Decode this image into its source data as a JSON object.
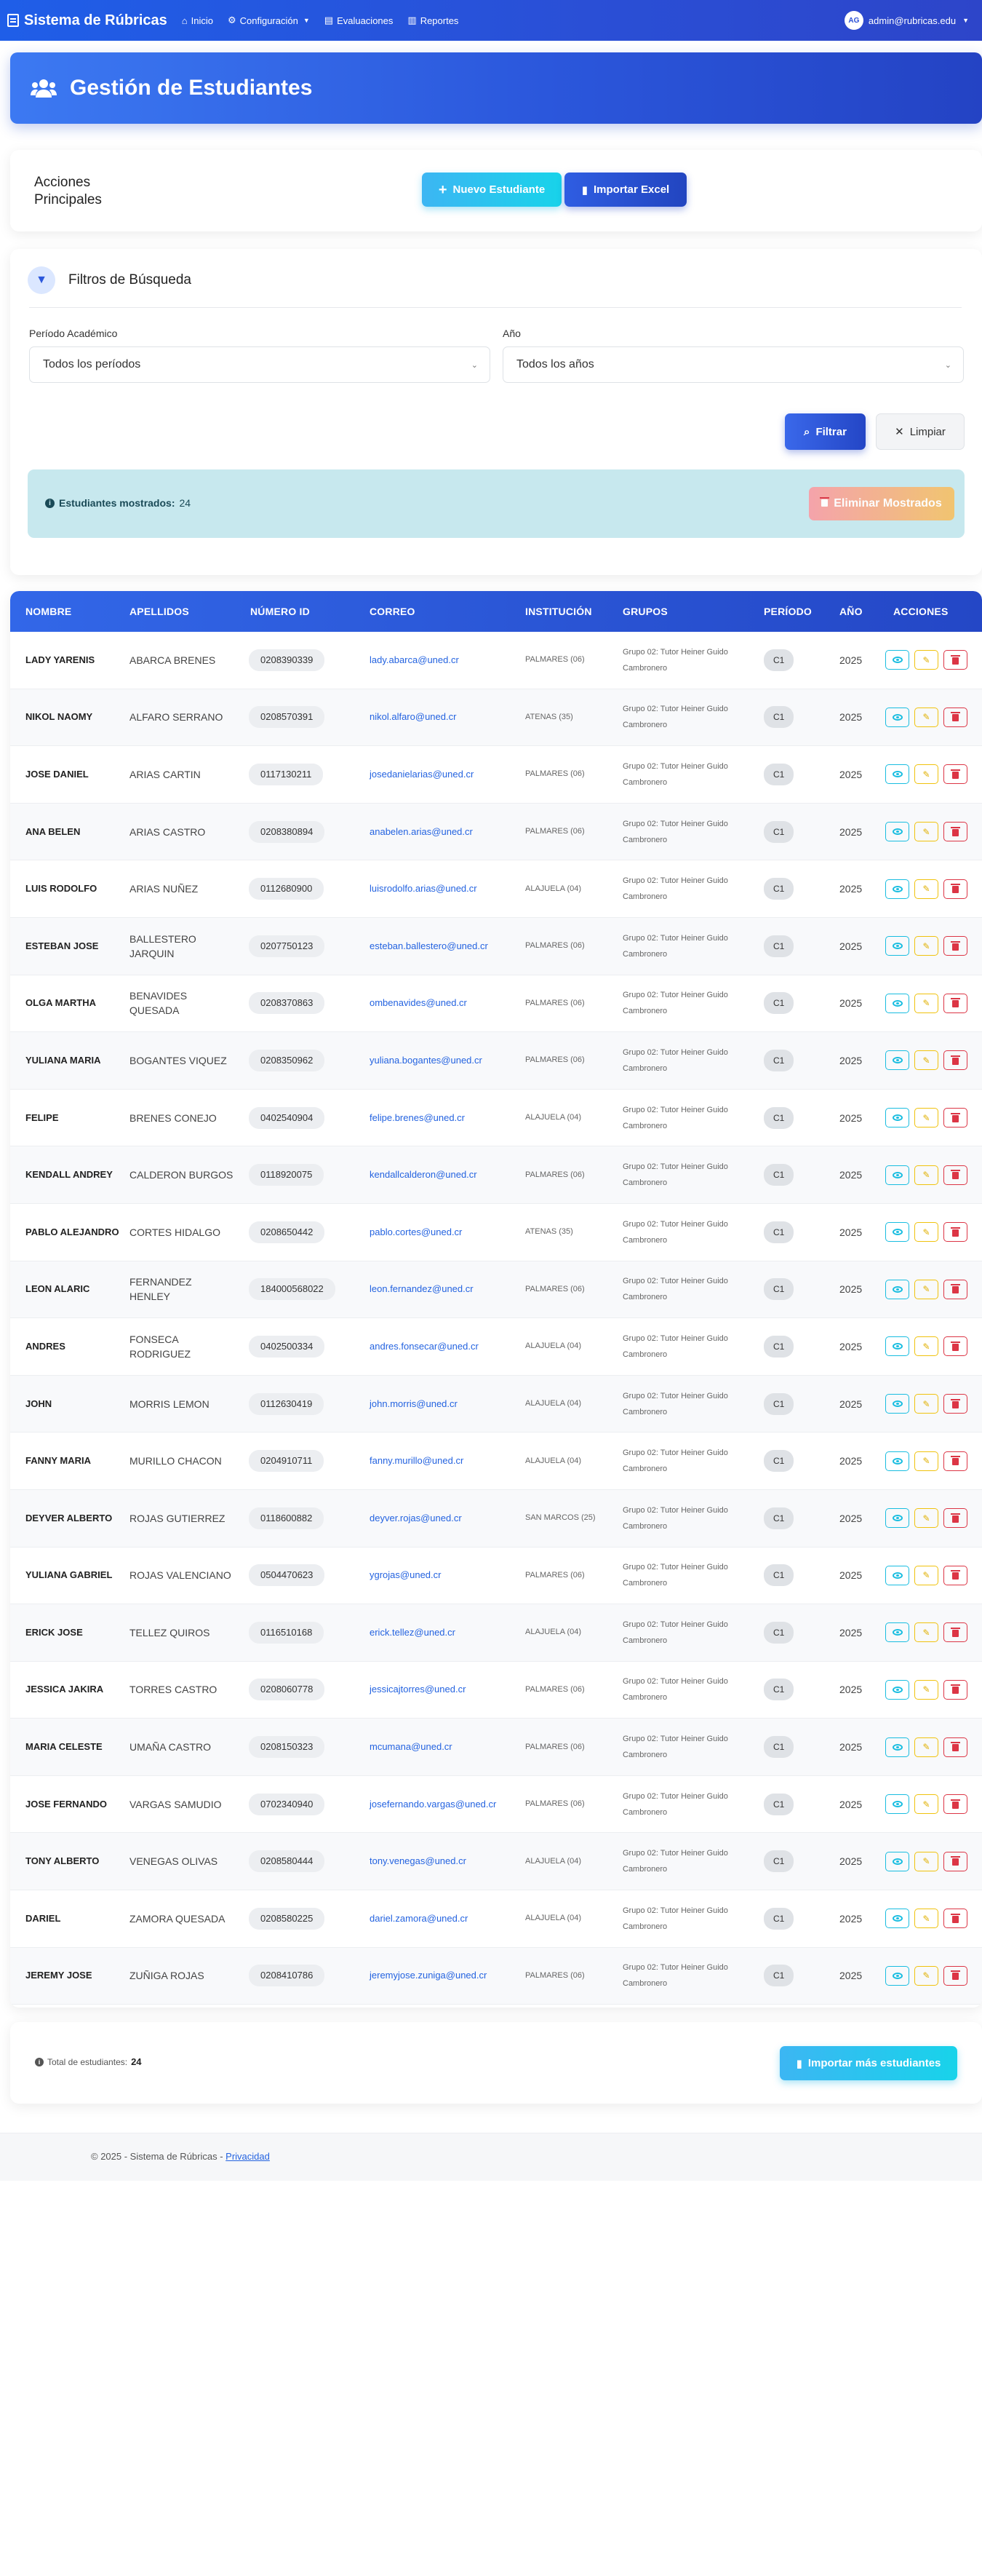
{
  "navbar": {
    "brand": "Sistema de Rúbricas",
    "links": [
      {
        "label": "Inicio",
        "icon": "home-icon",
        "dropdown": false
      },
      {
        "label": "Configuración",
        "icon": "gear-icon",
        "dropdown": true
      },
      {
        "label": "Evaluaciones",
        "icon": "clipboard-icon",
        "dropdown": false
      },
      {
        "label": "Reportes",
        "icon": "chart-icon",
        "dropdown": false
      }
    ],
    "user_initials": "AG",
    "user_email": "admin@rubricas.edu"
  },
  "header": {
    "title": "Gestión de Estudiantes",
    "icon": "users-icon"
  },
  "actions": {
    "title": "Acciones Principales",
    "nuevo_label": "Nuevo Estudiante",
    "importar_label": "Importar Excel"
  },
  "filters": {
    "title": "Filtros de Búsqueda",
    "periodo_label": "Período Académico",
    "periodo_value": "Todos los períodos",
    "anio_label": "Año",
    "anio_value": "Todos los años",
    "filtrar_label": "Filtrar",
    "limpiar_label": "Limpiar",
    "shown_label": "Estudiantes mostrados:",
    "shown_count": "24",
    "eliminar_label": "Eliminar Mostrados"
  },
  "table": {
    "headers": [
      "NOMBRE",
      "APELLIDOS",
      "NÚMERO ID",
      "CORREO",
      "INSTITUCIÓN",
      "GRUPOS",
      "PERÍODO",
      "AÑO",
      "ACCIONES"
    ],
    "rows": [
      {
        "nombre": "LADY YARENIS",
        "apellidos": "ABARCA BRENES",
        "id": "0208390339",
        "correo": "lady.abarca@uned.cr",
        "inst": "PALMARES (06)",
        "grupo": "Grupo 02: Tutor Heiner Guido Cambronero",
        "periodo": "C1",
        "anio": "2025"
      },
      {
        "nombre": "NIKOL NAOMY",
        "apellidos": "ALFARO SERRANO",
        "id": "0208570391",
        "correo": "nikol.alfaro@uned.cr",
        "inst": "ATENAS (35)",
        "grupo": "Grupo 02: Tutor Heiner Guido Cambronero",
        "periodo": "C1",
        "anio": "2025"
      },
      {
        "nombre": "JOSE DANIEL",
        "apellidos": "ARIAS CARTIN",
        "id": "0117130211",
        "correo": "josedanielarias@uned.cr",
        "inst": "PALMARES (06)",
        "grupo": "Grupo 02: Tutor Heiner Guido Cambronero",
        "periodo": "C1",
        "anio": "2025"
      },
      {
        "nombre": "ANA BELEN",
        "apellidos": "ARIAS CASTRO",
        "id": "0208380894",
        "correo": "anabelen.arias@uned.cr",
        "inst": "PALMARES (06)",
        "grupo": "Grupo 02: Tutor Heiner Guido Cambronero",
        "periodo": "C1",
        "anio": "2025"
      },
      {
        "nombre": "LUIS RODOLFO",
        "apellidos": "ARIAS NUÑEZ",
        "id": "0112680900",
        "correo": "luisrodolfo.arias@uned.cr",
        "inst": "ALAJUELA (04)",
        "grupo": "Grupo 02: Tutor Heiner Guido Cambronero",
        "periodo": "C1",
        "anio": "2025"
      },
      {
        "nombre": "ESTEBAN JOSE",
        "apellidos": "BALLESTERO JARQUIN",
        "id": "0207750123",
        "correo": "esteban.ballestero@uned.cr",
        "inst": "PALMARES (06)",
        "grupo": "Grupo 02: Tutor Heiner Guido Cambronero",
        "periodo": "C1",
        "anio": "2025"
      },
      {
        "nombre": "OLGA MARTHA",
        "apellidos": "BENAVIDES QUESADA",
        "id": "0208370863",
        "correo": "ombenavides@uned.cr",
        "inst": "PALMARES (06)",
        "grupo": "Grupo 02: Tutor Heiner Guido Cambronero",
        "periodo": "C1",
        "anio": "2025"
      },
      {
        "nombre": "YULIANA MARIA",
        "apellidos": "BOGANTES VIQUEZ",
        "id": "0208350962",
        "correo": "yuliana.bogantes@uned.cr",
        "inst": "PALMARES (06)",
        "grupo": "Grupo 02: Tutor Heiner Guido Cambronero",
        "periodo": "C1",
        "anio": "2025"
      },
      {
        "nombre": "FELIPE",
        "apellidos": "BRENES CONEJO",
        "id": "0402540904",
        "correo": "felipe.brenes@uned.cr",
        "inst": "ALAJUELA (04)",
        "grupo": "Grupo 02: Tutor Heiner Guido Cambronero",
        "periodo": "C1",
        "anio": "2025"
      },
      {
        "nombre": "KENDALL ANDREY",
        "apellidos": "CALDERON BURGOS",
        "id": "0118920075",
        "correo": "kendallcalderon@uned.cr",
        "inst": "PALMARES (06)",
        "grupo": "Grupo 02: Tutor Heiner Guido Cambronero",
        "periodo": "C1",
        "anio": "2025"
      },
      {
        "nombre": "PABLO ALEJANDRO",
        "apellidos": "CORTES HIDALGO",
        "id": "0208650442",
        "correo": "pablo.cortes@uned.cr",
        "inst": "ATENAS (35)",
        "grupo": "Grupo 02: Tutor Heiner Guido Cambronero",
        "periodo": "C1",
        "anio": "2025"
      },
      {
        "nombre": "LEON ALARIC",
        "apellidos": "FERNANDEZ HENLEY",
        "id": "184000568022",
        "correo": "leon.fernandez@uned.cr",
        "inst": "PALMARES (06)",
        "grupo": "Grupo 02: Tutor Heiner Guido Cambronero",
        "periodo": "C1",
        "anio": "2025"
      },
      {
        "nombre": "ANDRES",
        "apellidos": "FONSECA RODRIGUEZ",
        "id": "0402500334",
        "correo": "andres.fonsecar@uned.cr",
        "inst": "ALAJUELA (04)",
        "grupo": "Grupo 02: Tutor Heiner Guido Cambronero",
        "periodo": "C1",
        "anio": "2025"
      },
      {
        "nombre": "JOHN",
        "apellidos": "MORRIS LEMON",
        "id": "0112630419",
        "correo": "john.morris@uned.cr",
        "inst": "ALAJUELA (04)",
        "grupo": "Grupo 02: Tutor Heiner Guido Cambronero",
        "periodo": "C1",
        "anio": "2025"
      },
      {
        "nombre": "FANNY MARIA",
        "apellidos": "MURILLO CHACON",
        "id": "0204910711",
        "correo": "fanny.murillo@uned.cr",
        "inst": "ALAJUELA (04)",
        "grupo": "Grupo 02: Tutor Heiner Guido Cambronero",
        "periodo": "C1",
        "anio": "2025"
      },
      {
        "nombre": "DEYVER ALBERTO",
        "apellidos": "ROJAS GUTIERREZ",
        "id": "0118600882",
        "correo": "deyver.rojas@uned.cr",
        "inst": "SAN MARCOS (25)",
        "grupo": "Grupo 02: Tutor Heiner Guido Cambronero",
        "periodo": "C1",
        "anio": "2025"
      },
      {
        "nombre": "YULIANA GABRIEL",
        "apellidos": "ROJAS VALENCIANO",
        "id": "0504470623",
        "correo": "ygrojas@uned.cr",
        "inst": "PALMARES (06)",
        "grupo": "Grupo 02: Tutor Heiner Guido Cambronero",
        "periodo": "C1",
        "anio": "2025"
      },
      {
        "nombre": "ERICK JOSE",
        "apellidos": "TELLEZ QUIROS",
        "id": "0116510168",
        "correo": "erick.tellez@uned.cr",
        "inst": "ALAJUELA (04)",
        "grupo": "Grupo 02: Tutor Heiner Guido Cambronero",
        "periodo": "C1",
        "anio": "2025"
      },
      {
        "nombre": "JESSICA JAKIRA",
        "apellidos": "TORRES CASTRO",
        "id": "0208060778",
        "correo": "jessicajtorres@uned.cr",
        "inst": "PALMARES (06)",
        "grupo": "Grupo 02: Tutor Heiner Guido Cambronero",
        "periodo": "C1",
        "anio": "2025"
      },
      {
        "nombre": "MARIA CELESTE",
        "apellidos": "UMAÑA CASTRO",
        "id": "0208150323",
        "correo": "mcumana@uned.cr",
        "inst": "PALMARES (06)",
        "grupo": "Grupo 02: Tutor Heiner Guido Cambronero",
        "periodo": "C1",
        "anio": "2025"
      },
      {
        "nombre": "JOSE FERNANDO",
        "apellidos": "VARGAS SAMUDIO",
        "id": "0702340940",
        "correo": "josefernando.vargas@uned.cr",
        "inst": "PALMARES (06)",
        "grupo": "Grupo 02: Tutor Heiner Guido Cambronero",
        "periodo": "C1",
        "anio": "2025"
      },
      {
        "nombre": "TONY ALBERTO",
        "apellidos": "VENEGAS OLIVAS",
        "id": "0208580444",
        "correo": "tony.venegas@uned.cr",
        "inst": "ALAJUELA (04)",
        "grupo": "Grupo 02: Tutor Heiner Guido Cambronero",
        "periodo": "C1",
        "anio": "2025"
      },
      {
        "nombre": "DARIEL",
        "apellidos": "ZAMORA QUESADA",
        "id": "0208580225",
        "correo": "dariel.zamora@uned.cr",
        "inst": "ALAJUELA (04)",
        "grupo": "Grupo 02: Tutor Heiner Guido Cambronero",
        "periodo": "C1",
        "anio": "2025"
      },
      {
        "nombre": "JEREMY JOSE",
        "apellidos": "ZUÑIGA ROJAS",
        "id": "0208410786",
        "correo": "jeremyjose.zuniga@uned.cr",
        "inst": "PALMARES (06)",
        "grupo": "Grupo 02: Tutor Heiner Guido Cambronero",
        "periodo": "C1",
        "anio": "2025"
      }
    ]
  },
  "summary": {
    "total_label": "Total de estudiantes:",
    "total_count": "24",
    "importar_mas_label": "Importar más estudiantes"
  },
  "footer": {
    "copyright": "© 2025 - Sistema de Rúbricas -",
    "privacy_link": "Privacidad"
  },
  "colors": {
    "primary": "#2b57dc",
    "accent_cyan": "#18d3ea",
    "danger": "#dc3545",
    "warning": "#f0c20d",
    "info_bg": "#c7e8ee"
  }
}
